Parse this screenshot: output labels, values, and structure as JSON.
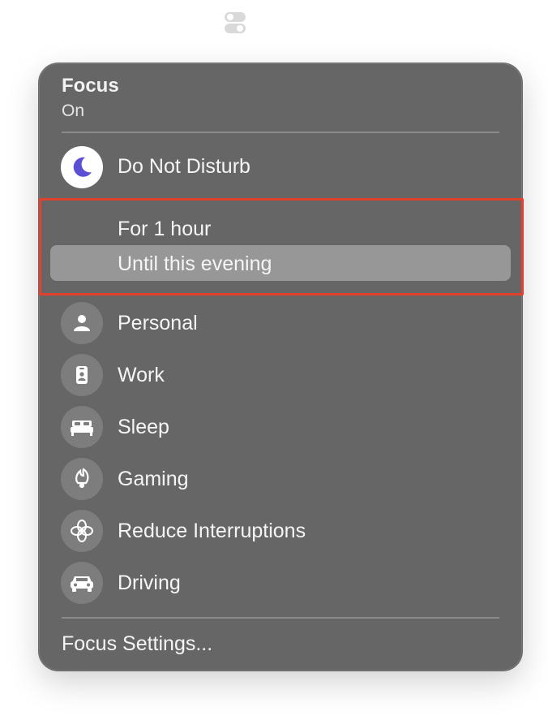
{
  "menubar": {
    "icon": "control-center-icon"
  },
  "focus_menu": {
    "title": "Focus",
    "status": "On",
    "active_mode": {
      "label": "Do Not Disturb",
      "icon": "moon-icon",
      "icon_color": "#5b4fd6"
    },
    "duration_options": [
      {
        "label": "For 1 hour",
        "selected": false
      },
      {
        "label": "Until this evening",
        "selected": true
      }
    ],
    "modes": [
      {
        "label": "Personal",
        "icon": "person-icon"
      },
      {
        "label": "Work",
        "icon": "id-badge-icon"
      },
      {
        "label": "Sleep",
        "icon": "bed-icon"
      },
      {
        "label": "Gaming",
        "icon": "rocket-icon"
      },
      {
        "label": "Reduce Interruptions",
        "icon": "flower-icon"
      },
      {
        "label": "Driving",
        "icon": "car-icon"
      }
    ],
    "settings_label": "Focus Settings..."
  },
  "colors": {
    "panel_bg": "#666666",
    "selected_bg": "#979797",
    "annotation_border": "#e2412b"
  }
}
